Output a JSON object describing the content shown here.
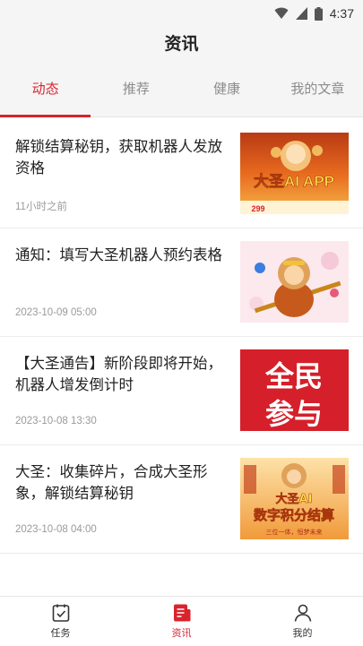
{
  "status_bar": {
    "time": "4:37"
  },
  "header": {
    "title": "资讯"
  },
  "tabs": [
    {
      "label": "动态",
      "active": true
    },
    {
      "label": "推荐",
      "active": false
    },
    {
      "label": "健康",
      "active": false
    },
    {
      "label": "我的文章",
      "active": false
    }
  ],
  "articles": [
    {
      "title": "解锁结算秘钥，获取机器人发放资格",
      "time": "11小时之前",
      "thumb": {
        "text": "大圣AI APP",
        "subtext": "299"
      }
    },
    {
      "title": "通知：填写大圣机器人预约表格",
      "time": "2023-10-09 05:00",
      "thumb": {
        "text": ""
      }
    },
    {
      "title": "【大圣通告】新阶段即将开始，机器人增发倒计时",
      "time": "2023-10-08 13:30",
      "thumb": {
        "text_line1": "全民",
        "text_line2": "参与"
      }
    },
    {
      "title": "大圣：收集碎片，合成大圣形象，解锁结算秘钥",
      "time": "2023-10-08 04:00",
      "thumb": {
        "text_line1": "大圣AI",
        "text_line2": "数字积分结算",
        "text_line3": "三位一体，恒梦未来"
      }
    }
  ],
  "bottom_nav": [
    {
      "label": "任务",
      "icon": "task-icon",
      "active": false
    },
    {
      "label": "资讯",
      "icon": "news-icon",
      "active": true
    },
    {
      "label": "我的",
      "icon": "user-icon",
      "active": false
    }
  ],
  "colors": {
    "accent": "#d9232d",
    "header_bg": "#f5f5f5"
  }
}
